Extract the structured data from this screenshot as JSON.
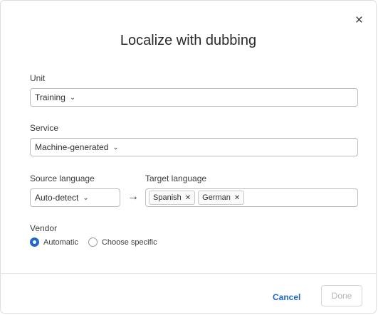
{
  "dialog": {
    "title": "Localize with dubbing",
    "close_icon": "×"
  },
  "unit": {
    "label": "Unit",
    "value": "Training",
    "chevron": "⌄"
  },
  "service": {
    "label": "Service",
    "value": "Machine-generated",
    "chevron": "⌄"
  },
  "source_language": {
    "label": "Source language",
    "value": "Auto-detect",
    "chevron": "⌄"
  },
  "arrow": "→",
  "target_language": {
    "label": "Target language",
    "chips": [
      {
        "label": "Spanish",
        "remove_icon": "✕"
      },
      {
        "label": "German",
        "remove_icon": "✕"
      }
    ]
  },
  "vendor": {
    "label": "Vendor",
    "options": [
      {
        "label": "Automatic",
        "selected": true
      },
      {
        "label": "Choose specific",
        "selected": false
      }
    ]
  },
  "footer": {
    "cancel_label": "Cancel",
    "done_label": "Done"
  },
  "colors": {
    "accent": "#1f66c8"
  }
}
